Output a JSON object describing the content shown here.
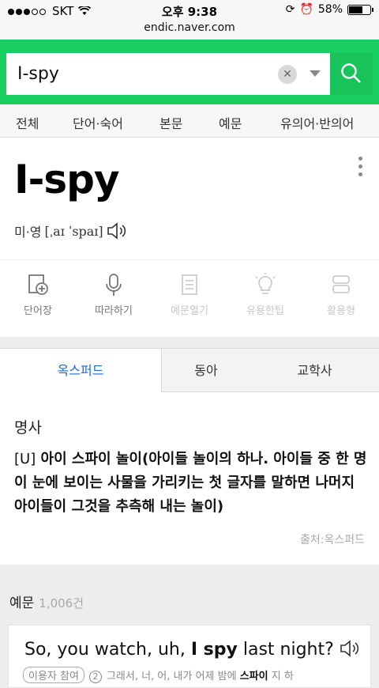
{
  "status": {
    "carrier": "SKT",
    "time": "오후 9:38",
    "battery": "58%"
  },
  "url": "endic.naver.com",
  "search": {
    "query": "I-spy"
  },
  "category_tabs": [
    "전체",
    "단어·숙어",
    "본문",
    "예문",
    "유의어·반의어"
  ],
  "entry": {
    "word": "I-spy",
    "pron_label": "미·영",
    "pron_ipa": "[ˌaɪ ˈspaɪ]"
  },
  "tools": [
    {
      "label": "단어장",
      "icon": "add-wordbook-icon",
      "state": "active"
    },
    {
      "label": "따라하기",
      "icon": "microphone-icon",
      "state": "active"
    },
    {
      "label": "예문열기",
      "icon": "document-icon",
      "state": "disabled"
    },
    {
      "label": "유용한팁",
      "icon": "lightbulb-icon",
      "state": "disabled"
    },
    {
      "label": "활용형",
      "icon": "layers-icon",
      "state": "disabled"
    }
  ],
  "source_tabs": [
    "옥스퍼드",
    "동아",
    "교학사"
  ],
  "definition": {
    "pos": "명사",
    "mark": "[U]",
    "text": "아이 스파이 놀이(아이들 놀이의 하나. 아이들 중 한 명이 눈에 보이는 사물을 가리키는 첫 글자를 말하면 나머지 아이들이 그것을 추측해 내는 놀이)",
    "source": "출처:옥스퍼드"
  },
  "examples": {
    "label": "예문",
    "count": "1,006건",
    "first": {
      "before": "So, you watch, uh, ",
      "bold": "I spy",
      "after": " last night?",
      "tag": "이용자 참여",
      "num": "2",
      "translation_before": "그래서, 너, 어, 내가 어제 밤에 ",
      "translation_bold": "스파이",
      "translation_after": " 지 하"
    }
  },
  "colors": {
    "brand": "#19ce60",
    "active_tab": "#1c6ad6"
  }
}
